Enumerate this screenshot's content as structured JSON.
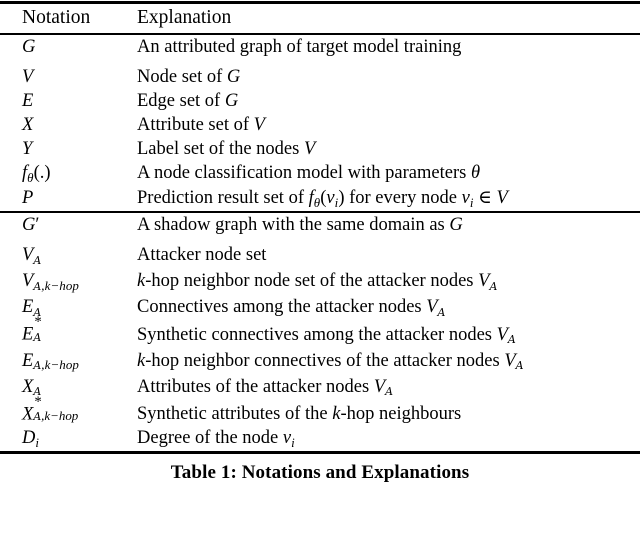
{
  "table": {
    "columns": {
      "notation": "Notation",
      "explanation": "Explanation"
    },
    "section_1": [
      {
        "notation": "G",
        "explanation": "An attributed graph of target model training"
      },
      {
        "notation": "V",
        "explanation": "Node set of G"
      },
      {
        "notation": "E",
        "explanation": "Edge set of G"
      },
      {
        "notation": "X",
        "explanation": "Attribute set of V"
      },
      {
        "notation": "Y",
        "explanation": "Label set of the nodes V"
      },
      {
        "notation": "f_θ(.)",
        "explanation": "A node classification model with parameters θ"
      },
      {
        "notation": "P",
        "explanation": "Prediction result set of f_θ(v_i) for every node v_i ∈ V"
      }
    ],
    "section_2": [
      {
        "notation": "G′",
        "explanation": "A shadow graph with the same domain as G"
      },
      {
        "notation": "V_𝒜",
        "explanation": "Attacker node set"
      },
      {
        "notation": "V_{𝒜,k−hop}",
        "explanation": "k-hop neighbor node set of the attacker nodes V_𝒜"
      },
      {
        "notation": "E_𝒜",
        "explanation": "Connectives among the attacker nodes V_𝒜"
      },
      {
        "notation": "E*_𝒜",
        "explanation": "Synthetic connectives among the attacker nodes V_𝒜"
      },
      {
        "notation": "E_{𝒜,k−hop}",
        "explanation": "k-hop neighbor connectives of the attacker nodes V_𝒜"
      },
      {
        "notation": "X_𝒜",
        "explanation": "Attributes of the attacker nodes V_𝒜"
      },
      {
        "notation": "X*_{𝒜,k−hop}",
        "explanation": "Synthetic attributes of the k-hop neighbours"
      },
      {
        "notation": "D_i",
        "explanation": "Degree of the node v_i"
      }
    ],
    "caption": "Table 1: Notations and Explanations"
  }
}
